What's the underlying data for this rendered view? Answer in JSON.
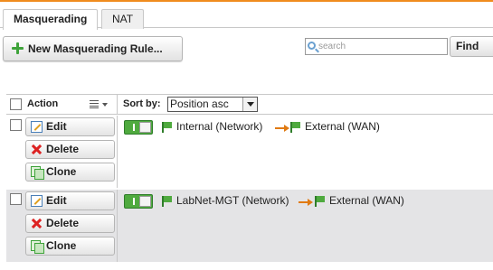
{
  "tabs": [
    {
      "label": "Masquerading",
      "active": true
    },
    {
      "label": "NAT",
      "active": false
    }
  ],
  "toolbar": {
    "new_rule_label": "New Masquerading Rule...",
    "search_placeholder": "search",
    "find_label": "Find"
  },
  "list": {
    "action_header": "Action",
    "sort_label": "Sort by:",
    "sort_value": "Position asc"
  },
  "rules": [
    {
      "edit_label": "Edit",
      "delete_label": "Delete",
      "clone_label": "Clone",
      "enabled": true,
      "source": "Internal (Network)",
      "destination": "External (WAN)"
    },
    {
      "edit_label": "Edit",
      "delete_label": "Delete",
      "clone_label": "Clone",
      "enabled": true,
      "source": "LabNet-MGT (Network)",
      "destination": "External (WAN)"
    }
  ],
  "colors": {
    "accent_orange": "#f08c1e",
    "enabled_green": "#4faa3f",
    "delete_red": "#dd2222",
    "row_alt_bg": "#e4e4e6"
  },
  "icons": [
    "plus-icon",
    "search-icon",
    "list-icon",
    "edit-icon",
    "delete-icon",
    "clone-icon",
    "network-flag-icon",
    "arrow-right-icon"
  ]
}
